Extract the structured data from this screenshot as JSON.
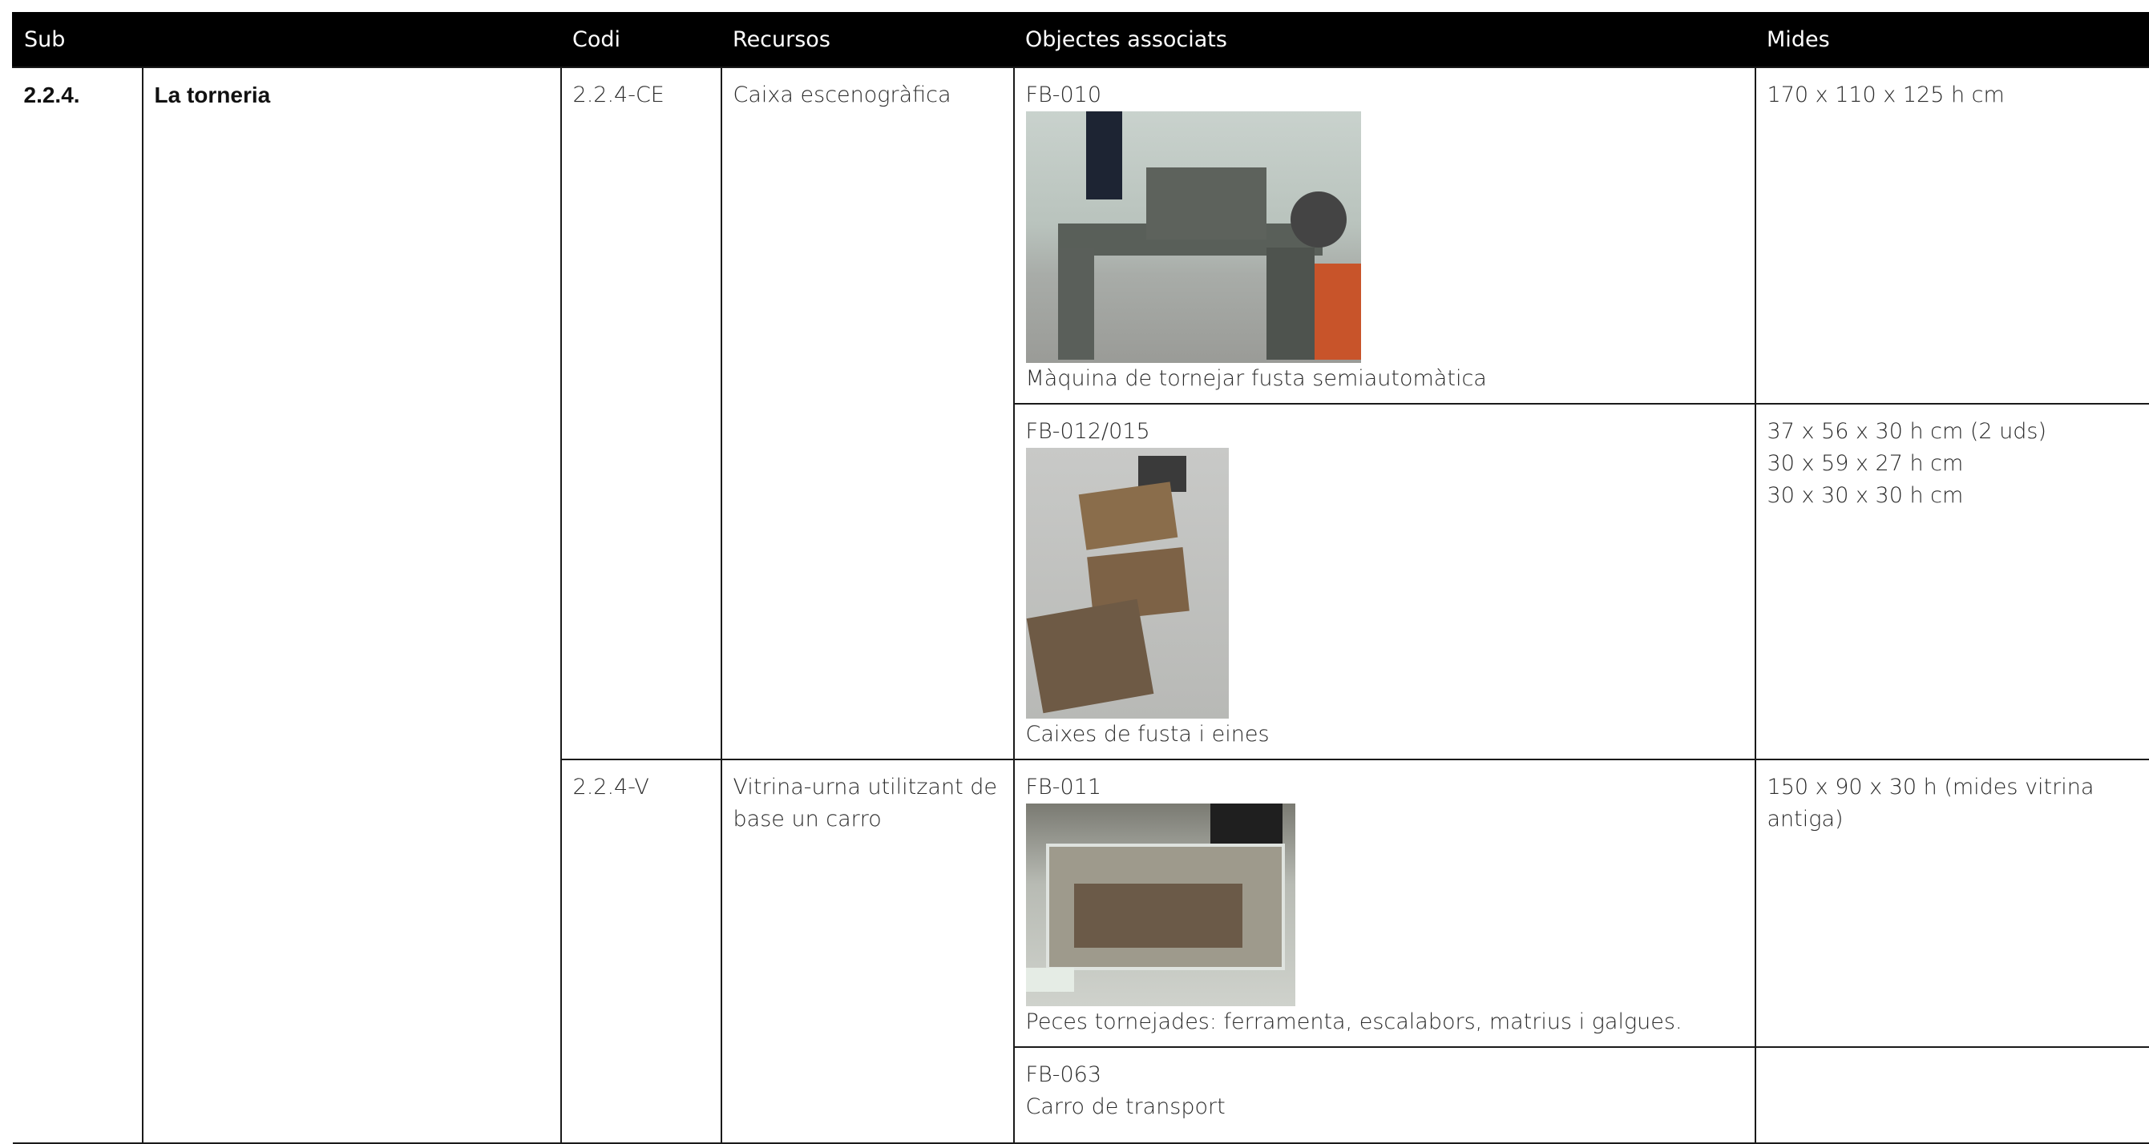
{
  "table": {
    "headers": [
      "Sub",
      "Codi",
      "Recursos",
      "Objectes associats",
      "Mides"
    ],
    "sub_number": "2.2.4.",
    "sub_title": "La torneria",
    "resources": [
      {
        "code": "2.2.4-CE",
        "name": "Caixa escenogràfica"
      },
      {
        "code": "2.2.4-V",
        "name": "Vitrina-urna utilitzant de base un carro"
      }
    ],
    "objects": [
      {
        "code": "FB-010",
        "photo": "lathe-photo",
        "caption": "Màquina de tornejar fusta semiautomàtica",
        "sizes": [
          "170 x 110 x 125 h cm"
        ]
      },
      {
        "code": "FB-012/015",
        "photo": "boxes-photo",
        "caption": "Caixes de fusta i eines",
        "sizes": [
          "37 x 56 x 30 h cm (2 uds)",
          "30 x 59 x 27 h cm",
          "30 x 30 x 30 h cm"
        ]
      },
      {
        "code": "FB-011",
        "photo": "display-case-photo",
        "caption": "Peces tornejades: ferramenta, escalabors, matrius i galgues.",
        "sizes": [
          "150 x 90 x 30 h (mides vitrina antiga)"
        ]
      },
      {
        "code": "FB-063",
        "caption": "Carro de transport",
        "sizes": []
      }
    ]
  }
}
